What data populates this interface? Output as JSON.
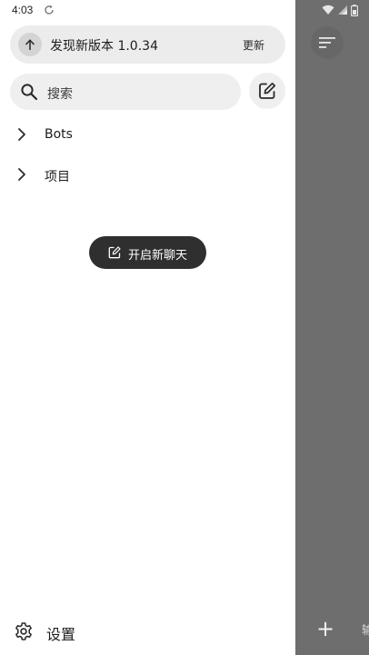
{
  "status_bar": {
    "time": "4:03"
  },
  "update_banner": {
    "text": "发现新版本 1.0.34",
    "action": "更新"
  },
  "search": {
    "placeholder": "搜索"
  },
  "nav_items": [
    {
      "label": "Bots"
    },
    {
      "label": "项目"
    }
  ],
  "new_chat": {
    "label": "开启新聊天"
  },
  "settings": {
    "label": "设置"
  },
  "background": {
    "trail_text": "输"
  },
  "colors": {
    "drawer_bg": "#ffffff",
    "scrim": "#6e6e6e",
    "pill_bg": "#2f2f2f",
    "banner_bg": "#ececec",
    "search_bg": "#efefef"
  }
}
